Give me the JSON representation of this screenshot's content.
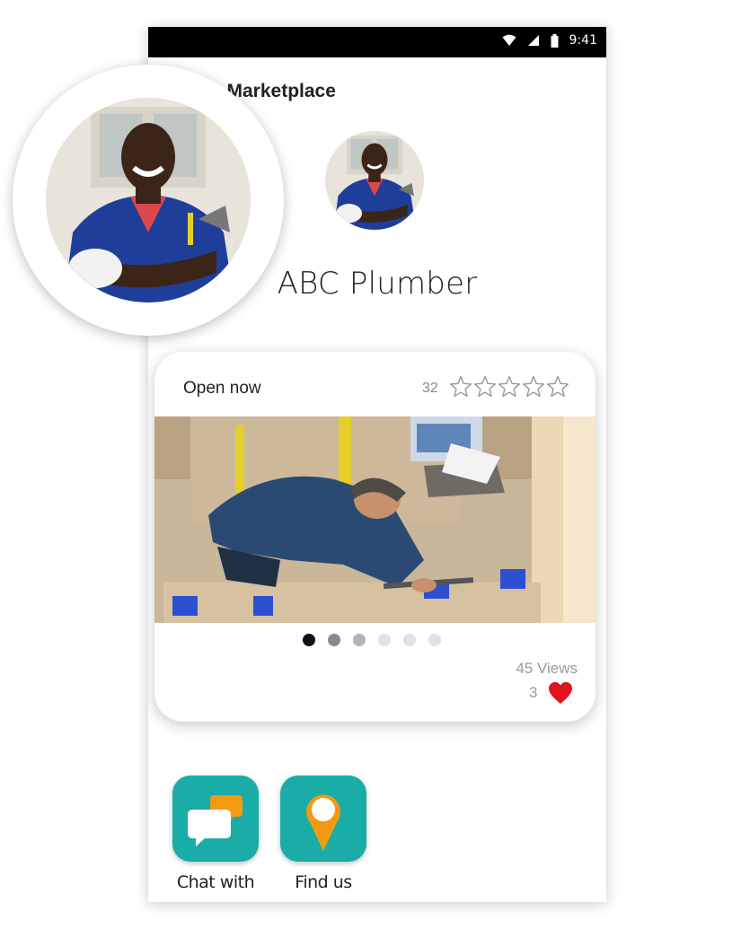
{
  "status_bar": {
    "time": "9:41"
  },
  "header": {
    "title": "» Marketplace"
  },
  "business": {
    "name": "ABC Plumber",
    "avatar_icon": "plumber-avatar"
  },
  "card": {
    "open_status": "Open now",
    "rating_count": "32",
    "rating_stars": 0,
    "rating_max": 5,
    "photo_icon": "plumber-working-photo",
    "carousel": {
      "total": 6,
      "active_index": 0
    },
    "views": "45 Views",
    "likes": "3"
  },
  "actions": [
    {
      "label": "Chat with",
      "icon": "chat-bubbles-icon"
    },
    {
      "label": "Find us",
      "icon": "map-pin-icon"
    }
  ],
  "colors": {
    "accent_teal": "#1aaca7",
    "heart_red": "#e0141e",
    "pin_orange": "#f39a12",
    "chat_orange": "#f39a12",
    "dot_active": "#111111",
    "dot_mid": "#8a8a8a",
    "dot_light": "#e2e2e2"
  }
}
